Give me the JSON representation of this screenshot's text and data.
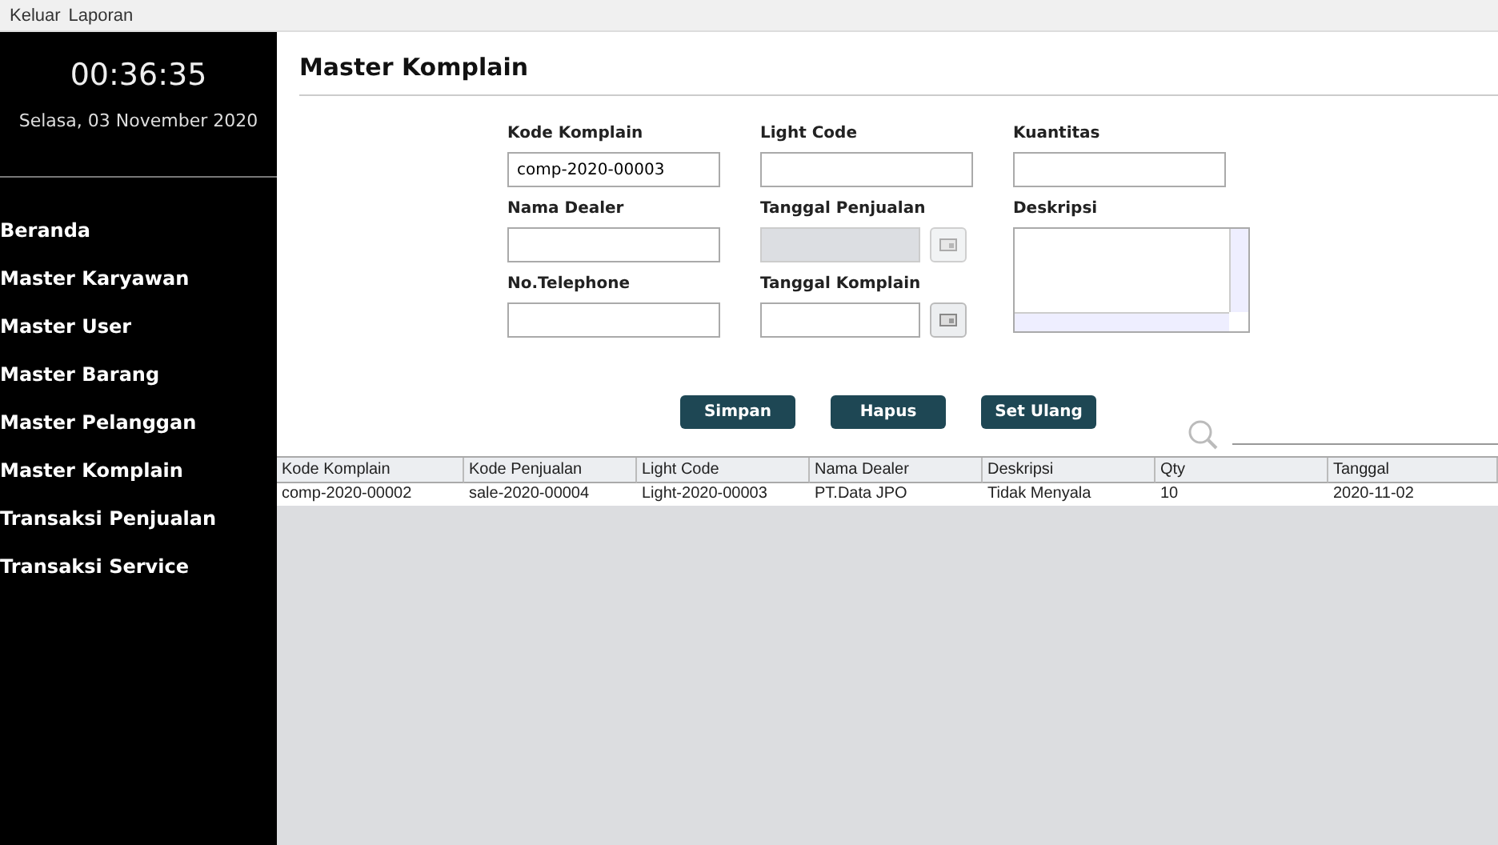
{
  "menu": [
    "Keluar",
    "Laporan"
  ],
  "sidebar": {
    "clock": "00:36:35",
    "date": "Selasa, 03 November 2020",
    "items": [
      {
        "label": "Beranda",
        "selected": false
      },
      {
        "label": "Master Karyawan",
        "selected": false
      },
      {
        "label": "Master User",
        "selected": false
      },
      {
        "label": "Master Barang",
        "selected": false
      },
      {
        "label": "Master Pelanggan",
        "selected": false
      },
      {
        "label": "Master Komplain",
        "selected": false
      },
      {
        "label": "Transaksi Penjualan",
        "selected": false
      },
      {
        "label": "Transaksi Service",
        "selected": false
      }
    ]
  },
  "title": "Master Komplain",
  "form": {
    "columns": [
      [
        {
          "kind": "text",
          "label": "Kode Komplain",
          "value": "comp-2020-00003",
          "disabled": false
        },
        {
          "kind": "text",
          "label": "Nama Dealer",
          "disabled": false
        },
        {
          "kind": "text",
          "label": "No.Telephone",
          "disabled": false
        }
      ],
      [
        {
          "kind": "text",
          "label": "Light Code",
          "disabled": false
        },
        {
          "kind": "date",
          "label": "Tanggal Penjualan",
          "disabled": true
        },
        {
          "kind": "date",
          "label": "Tanggal Komplain",
          "disabled": false
        }
      ],
      [
        {
          "kind": "text",
          "label": "Kuantitas",
          "disabled": false
        },
        {
          "kind": "textarea",
          "label": "Deskripsi"
        }
      ]
    ]
  },
  "buttons": [
    "Simpan",
    "Hapus",
    "Set Ulang"
  ],
  "table": {
    "columns": [
      "Kode Komplain",
      "Kode Penjualan",
      "Light Code",
      "Nama Dealer",
      "Deskripsi",
      "Qty",
      "Tanggal"
    ],
    "rows": [
      [
        "comp-2020-00002",
        "sale-2020-00004",
        "Light-2020-00003",
        "PT.Data JPO",
        "Tidak Menyala",
        "10",
        "2020-11-02"
      ]
    ]
  }
}
